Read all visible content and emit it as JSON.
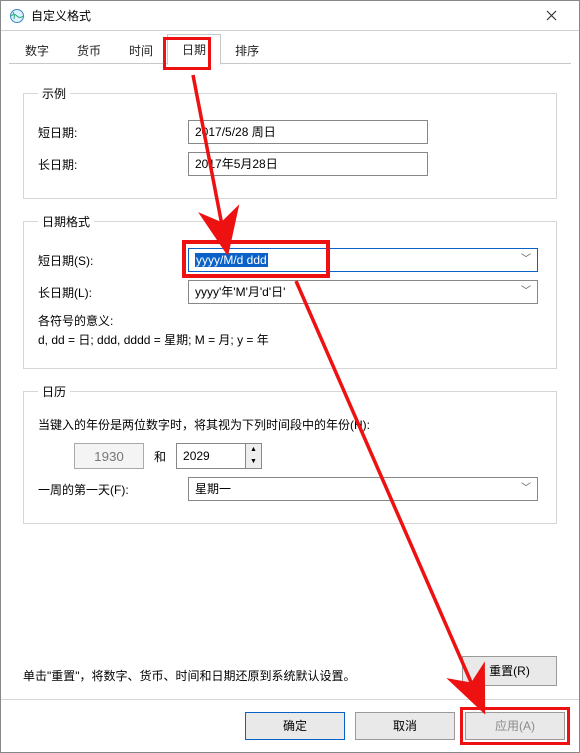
{
  "window": {
    "title": "自定义格式"
  },
  "tabs": {
    "number": "数字",
    "currency": "货币",
    "time": "时间",
    "date": "日期",
    "sort": "排序"
  },
  "example": {
    "legend": "示例",
    "short_label": "短日期:",
    "short_value": "2017/5/28 周日",
    "long_label": "长日期:",
    "long_value": "2017年5月28日"
  },
  "format": {
    "legend": "日期格式",
    "short_label": "短日期(S):",
    "short_value": "yyyy/M/d ddd",
    "long_label": "长日期(L):",
    "long_value": "yyyy'年'M'月'd'日'",
    "meaning_label": "各符号的意义:",
    "meaning_text": "d, dd = 日;  ddd, dddd = 星期;  M = 月;  y = 年"
  },
  "calendar": {
    "legend": "日历",
    "two_digit_label": "当键入的年份是两位数字时，将其视为下列时间段中的年份(H):",
    "year_from": "1930",
    "and": "和",
    "year_to": "2029",
    "first_day_label": "一周的第一天(F):",
    "first_day_value": "星期一"
  },
  "footer": {
    "note": "单击\"重置\"，将数字、货币、时间和日期还原到系统默认设置。",
    "reset": "重置(R)",
    "ok": "确定",
    "cancel": "取消",
    "apply": "应用(A)"
  }
}
